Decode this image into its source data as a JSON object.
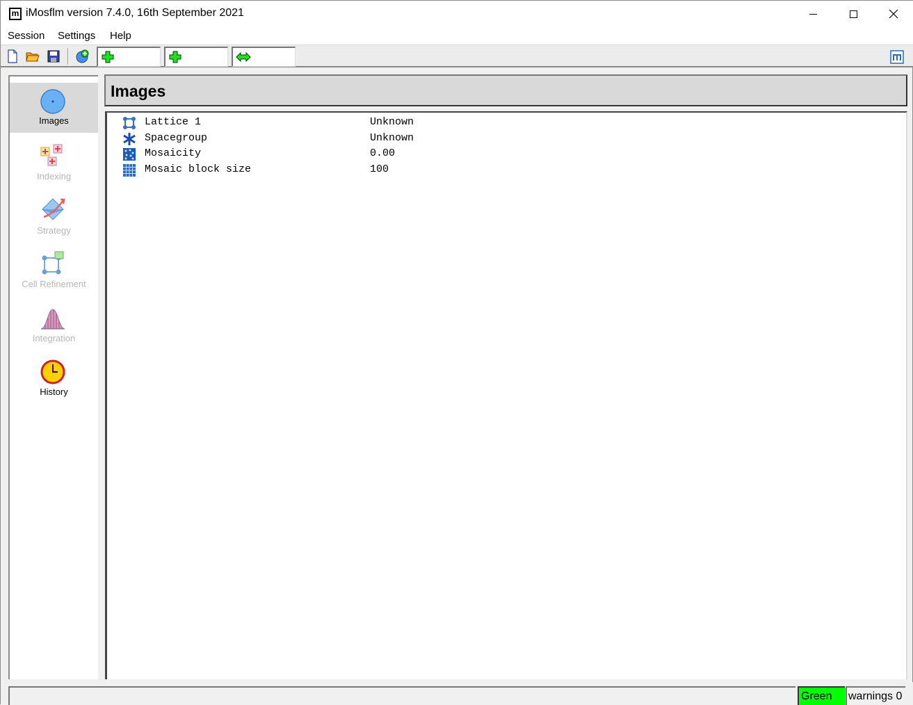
{
  "window": {
    "title": "iMosflm version 7.4.0, 16th September 2021",
    "app_icon_letter": "m"
  },
  "menu": {
    "items": [
      "Session",
      "Settings",
      "Help"
    ]
  },
  "toolbar": {
    "icons": [
      "new-file-icon",
      "open-folder-icon",
      "save-icon",
      "add-images-icon",
      "add-field-icon",
      "add-field-2-icon",
      "resize-field-icon",
      "mosflm-logo-icon"
    ]
  },
  "sidebar": {
    "items": [
      {
        "label": "Images",
        "icon": "images-icon",
        "active": true,
        "enabled": true
      },
      {
        "label": "Indexing",
        "icon": "indexing-icon",
        "active": false,
        "enabled": false
      },
      {
        "label": "Strategy",
        "icon": "strategy-icon",
        "active": false,
        "enabled": false
      },
      {
        "label": "Cell Refinement",
        "icon": "cell-refinement-icon",
        "active": false,
        "enabled": false
      },
      {
        "label": "Integration",
        "icon": "integration-icon",
        "active": false,
        "enabled": false
      },
      {
        "label": "History",
        "icon": "history-icon",
        "active": false,
        "enabled": true
      }
    ]
  },
  "main": {
    "title": "Images",
    "properties": [
      {
        "label": "Lattice 1",
        "value": "Unknown",
        "icon": "lattice-icon"
      },
      {
        "label": "Spacegroup",
        "value": "Unknown",
        "icon": "spacegroup-icon"
      },
      {
        "label": "Mosaicity",
        "value": "0.00",
        "icon": "mosaicity-icon"
      },
      {
        "label": "Mosaic block size",
        "value": "100",
        "icon": "mosaic-block-icon"
      }
    ]
  },
  "status": {
    "message": "",
    "state": "Green",
    "warnings": "warnings 0",
    "colors": {
      "green": "#00ff00"
    }
  }
}
